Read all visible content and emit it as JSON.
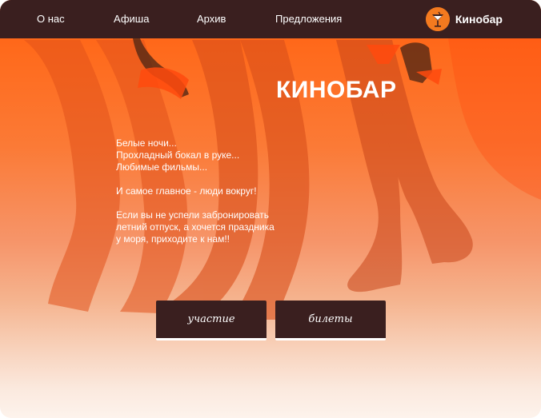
{
  "nav": {
    "items": [
      {
        "label": "О нас"
      },
      {
        "label": "Афиша"
      },
      {
        "label": "Архив"
      },
      {
        "label": "Предложения"
      }
    ],
    "brand": "Кинобар"
  },
  "hero": {
    "title": "КИНОБАР",
    "paragraphs": [
      [
        "Белые ночи...",
        "Прохладный бокал в руке...",
        "Любимые фильмы..."
      ],
      [
        "И самое главное - люди вокруг!"
      ],
      [
        "Если вы не успели забронировать",
        "летний отпуск, а хочется праздника",
        "у моря, приходите к нам!!"
      ]
    ],
    "buttons": {
      "participate": "участие",
      "tickets": "билеты"
    }
  },
  "colors": {
    "nav_bg": "#3a1f1f",
    "accent": "#ff5e12",
    "button_bg": "#3a1f1f"
  },
  "icons": {
    "logo": "cocktail-glass-icon"
  }
}
